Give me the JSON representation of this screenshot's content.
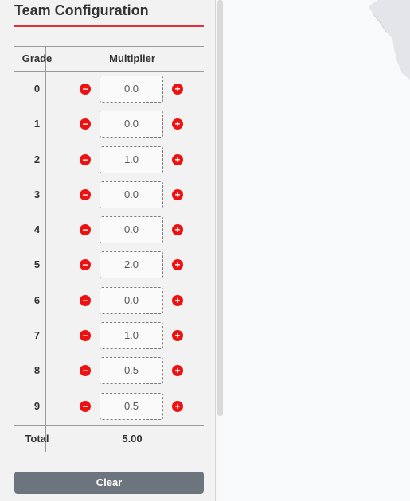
{
  "panel": {
    "title": "Team Configuration",
    "accent_color": "#e1303a"
  },
  "table": {
    "headers": {
      "grade": "Grade",
      "multiplier": "Multiplier"
    },
    "rows": [
      {
        "grade": "0",
        "value": "0.0"
      },
      {
        "grade": "1",
        "value": "0.0"
      },
      {
        "grade": "2",
        "value": "1.0"
      },
      {
        "grade": "3",
        "value": "0.0"
      },
      {
        "grade": "4",
        "value": "0.0"
      },
      {
        "grade": "5",
        "value": "2.0"
      },
      {
        "grade": "6",
        "value": "0.0"
      },
      {
        "grade": "7",
        "value": "1.0"
      },
      {
        "grade": "8",
        "value": "0.5"
      },
      {
        "grade": "9",
        "value": "0.5"
      }
    ],
    "total_label": "Total",
    "total_value": "5.00"
  },
  "buttons": {
    "decrement_icon": "minus-circle-icon",
    "increment_icon": "plus-circle-icon",
    "button_color": "#ee1111",
    "clear_label": "Clear",
    "clear_color": "#6c757d"
  }
}
